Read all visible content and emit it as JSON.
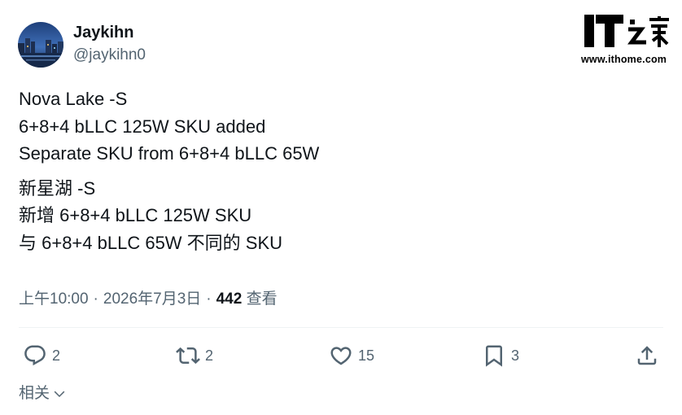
{
  "author": {
    "display_name": "Jaykihn",
    "handle": "@jaykihn0",
    "avatar_icon": "city-night-avatar-icon"
  },
  "watermark": {
    "logo_text": "IT之家",
    "url": "www.ithome.com"
  },
  "post": {
    "paragraphs": [
      {
        "lines": [
          "Nova Lake -S",
          "6+8+4 bLLC 125W SKU added",
          "Separate SKU from 6+8+4 bLLC 65W"
        ]
      },
      {
        "lines": [
          "新星湖 -S",
          "新增 6+8+4 bLLC 125W SKU",
          "与 6+8+4 bLLC 65W 不同的 SKU"
        ]
      }
    ],
    "time": "上午10:00",
    "separator": "·",
    "date": "2026年7月3日",
    "views_count": "442",
    "views_label": "查看"
  },
  "actions": {
    "reply": {
      "icon": "reply-icon",
      "count": "2"
    },
    "repost": {
      "icon": "repost-icon",
      "count": "2"
    },
    "like": {
      "icon": "heart-icon",
      "count": "15"
    },
    "bookmark": {
      "icon": "bookmark-icon",
      "count": "3"
    },
    "share": {
      "icon": "share-icon"
    }
  },
  "related": {
    "label": "相关",
    "icon": "chevron-down-icon"
  },
  "colors": {
    "text_primary": "#0f1419",
    "text_secondary": "#536471",
    "divider": "#eff3f4",
    "background": "#ffffff"
  }
}
